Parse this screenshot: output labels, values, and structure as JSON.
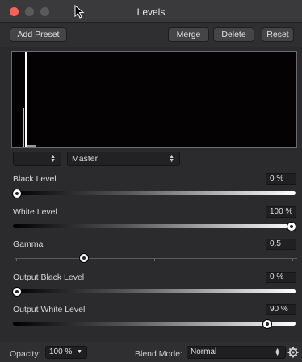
{
  "window": {
    "title": "Levels"
  },
  "toolbar": {
    "add_preset": "Add Preset",
    "merge": "Merge",
    "delete": "Delete",
    "reset": "Reset"
  },
  "channel": {
    "left_value": "",
    "selected": "Master"
  },
  "controls": {
    "black_level": {
      "label": "Black Level",
      "value": "0 %",
      "level": 0.0
    },
    "white_level": {
      "label": "White Level",
      "value": "100 %",
      "level": 1.0
    },
    "gamma": {
      "label": "Gamma",
      "value": "0.5",
      "level": 0.25
    },
    "output_black": {
      "label": "Output Black Level",
      "value": "0 %",
      "level": 0.0
    },
    "output_white": {
      "label": "Output White Level",
      "value": "90 %",
      "level": 0.9
    }
  },
  "bottom": {
    "opacity_label": "Opacity:",
    "opacity_value": "100 %",
    "blend_label": "Blend Mode:",
    "blend_value": "Normal"
  },
  "icons": [
    "close-icon",
    "minimize-icon",
    "maximize-icon",
    "cursor-icon",
    "gear-icon",
    "updown-arrows-icon",
    "dropdown-arrow-icon"
  ],
  "colors": {
    "close": "#ff5f57",
    "panel": "#2b2b2d",
    "histogram_bg": "#050203",
    "histogram_border": "#6a6a70"
  }
}
